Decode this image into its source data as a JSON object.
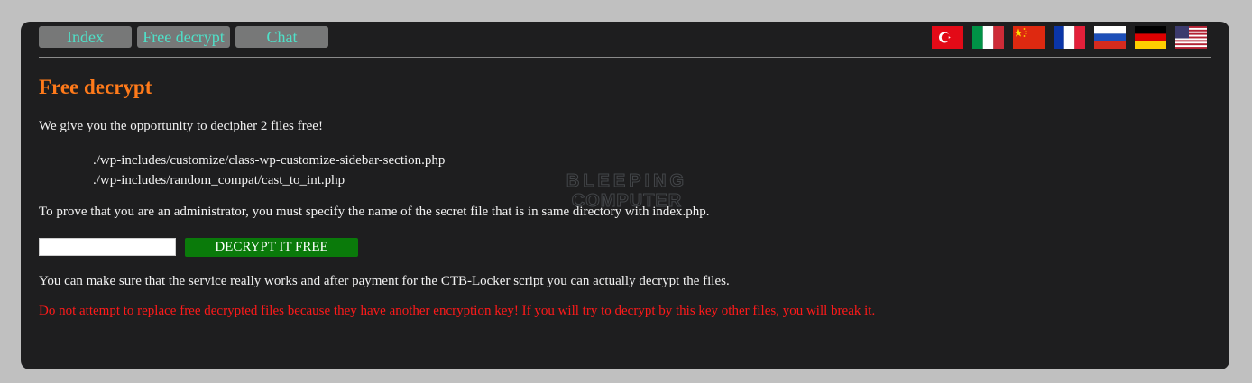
{
  "nav": {
    "items": [
      {
        "label": "Index"
      },
      {
        "label": "Free decrypt"
      },
      {
        "label": "Chat"
      }
    ]
  },
  "languages": [
    {
      "name": "turkey-flag-icon"
    },
    {
      "name": "italy-flag-icon"
    },
    {
      "name": "china-flag-icon"
    },
    {
      "name": "france-flag-icon"
    },
    {
      "name": "russia-flag-icon"
    },
    {
      "name": "germany-flag-icon"
    },
    {
      "name": "usa-flag-icon"
    }
  ],
  "page": {
    "title": "Free decrypt",
    "intro": "We give you the opportunity to decipher 2 files free!",
    "files": [
      "./wp-includes/customize/class-wp-customize-sidebar-section.php",
      "./wp-includes/random_compat/cast_to_int.php"
    ],
    "prove_text": "To prove that you are an administrator, you must specify the name of the secret file that is in same directory with index.php.",
    "secret_input_value": "",
    "decrypt_button_label": "DECRYPT IT FREE",
    "assurance_text": "You can make sure that the service really works and after payment for the CTB-Locker script you can actually decrypt the files.",
    "warning_text": "Do not attempt to replace free decrypted files because they have another encryption key! If you will try to decrypt by this key other files, you will break it."
  },
  "watermark": {
    "line1": "BLEEPING",
    "line2": "COMPUTER"
  },
  "colors": {
    "page_bg": "#c0c0c0",
    "panel_bg": "#1e1e1f",
    "nav_button_bg": "#777878",
    "nav_text": "#4fe0c8",
    "title": "#ff7a1a",
    "body_text": "#f2f2f2",
    "decrypt_button_bg": "#0a7a0a",
    "warning": "#ff1a1a"
  }
}
